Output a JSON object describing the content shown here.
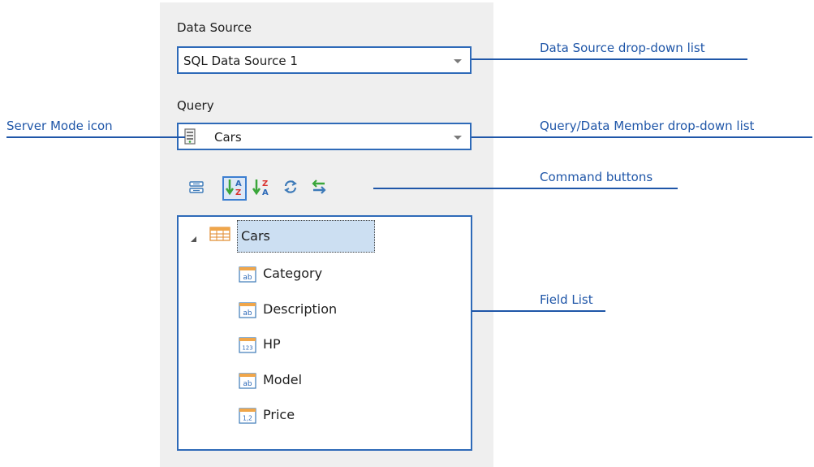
{
  "panel": {
    "data_source_label": "Data Source",
    "data_source_value": "SQL Data Source 1",
    "query_label": "Query",
    "query_value": "Cars"
  },
  "command_buttons": [
    {
      "icon": "collapse-icon"
    },
    {
      "icon": "sort-ascending-az-icon",
      "active": true
    },
    {
      "icon": "sort-descending-za-icon"
    },
    {
      "icon": "refresh-icon"
    },
    {
      "icon": "swap-icon"
    }
  ],
  "field_list": {
    "root": "Cars",
    "fields": [
      {
        "label": "Category",
        "icon": "string-field-icon",
        "icon_text": "ab"
      },
      {
        "label": "Description",
        "icon": "string-field-icon",
        "icon_text": "ab"
      },
      {
        "label": "HP",
        "icon": "integer-field-icon",
        "icon_text": "123"
      },
      {
        "label": "Model",
        "icon": "string-field-icon",
        "icon_text": "ab"
      },
      {
        "label": "Price",
        "icon": "decimal-field-icon",
        "icon_text": "1,2"
      }
    ]
  },
  "callouts": {
    "data_source": "Data Source drop-down list",
    "query": "Query/Data Member drop-down list",
    "server_mode": "Server Mode icon",
    "commands": "Command buttons",
    "field_list": "Field List"
  },
  "colors": {
    "callout": "#1f56a8",
    "border": "#2e6ab8",
    "panel_bg": "#efefef",
    "selection": "#ccdff2"
  }
}
